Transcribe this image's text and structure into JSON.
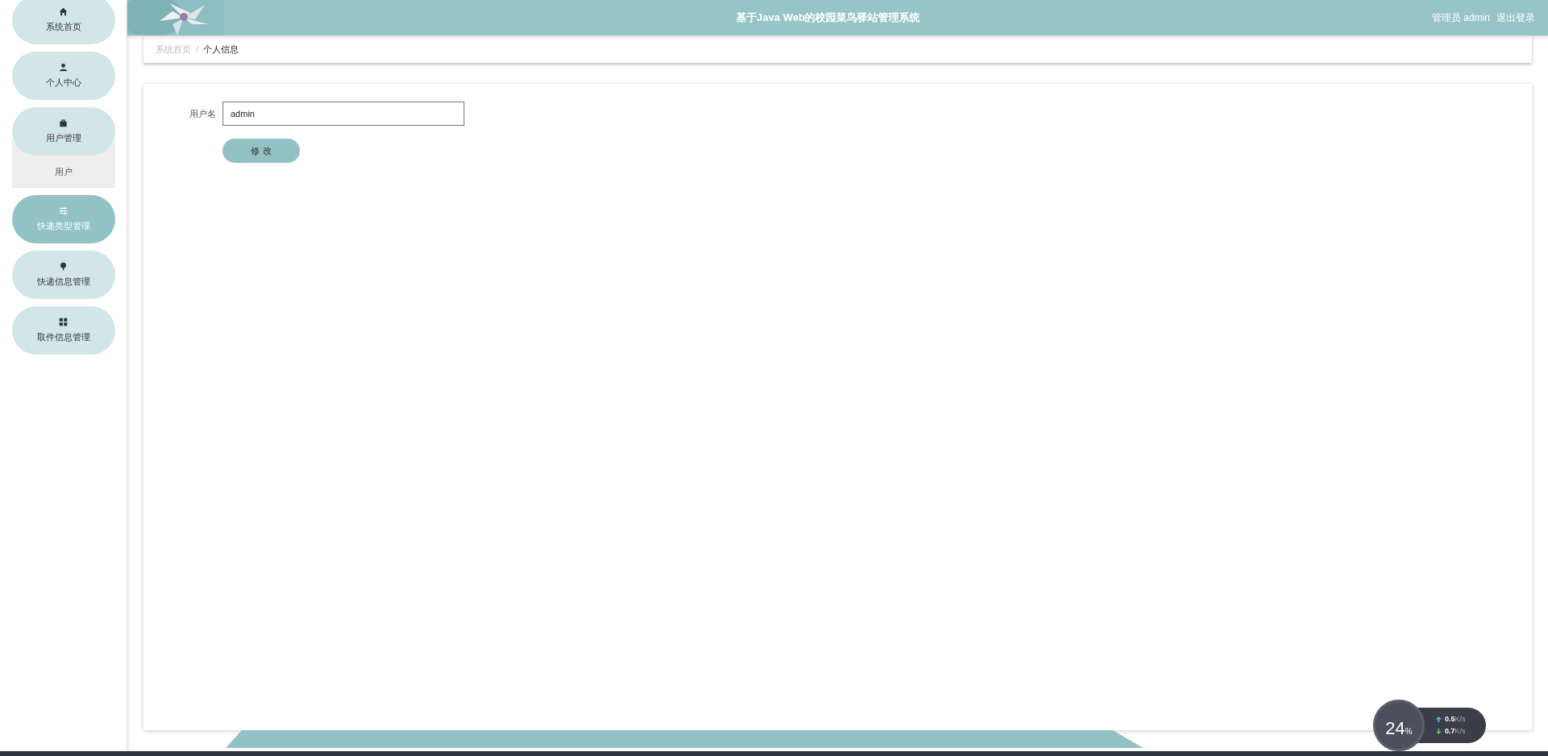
{
  "sidebar": {
    "items": [
      {
        "label": "系统首页",
        "selected": false
      },
      {
        "label": "个人中心",
        "selected": false
      },
      {
        "label": "用户管理",
        "selected": false,
        "expanded": true,
        "children": [
          {
            "label": "用户"
          }
        ]
      },
      {
        "label": "快递类型管理",
        "selected": true
      },
      {
        "label": "快递信息管理",
        "selected": false
      },
      {
        "label": "取件信息管理",
        "selected": false
      }
    ]
  },
  "header": {
    "title": "基于Java Web的校园菜鸟驿站管理系统",
    "role": "管理员 admin",
    "logout": "退出登录"
  },
  "breadcrumb_separator": "/",
  "breadcrumb": [
    {
      "label": "系统首页",
      "selected": false
    },
    {
      "label": "个人信息",
      "selected": true
    }
  ],
  "form": {
    "fields": [
      {
        "label": "用户名",
        "value": "admin"
      }
    ],
    "submit": "修 改"
  },
  "net_widget": {
    "percent": "24",
    "percent_unit": "%",
    "up": "0.5",
    "up_unit": "K/s",
    "down": "0.7",
    "down_unit": "K/s"
  }
}
